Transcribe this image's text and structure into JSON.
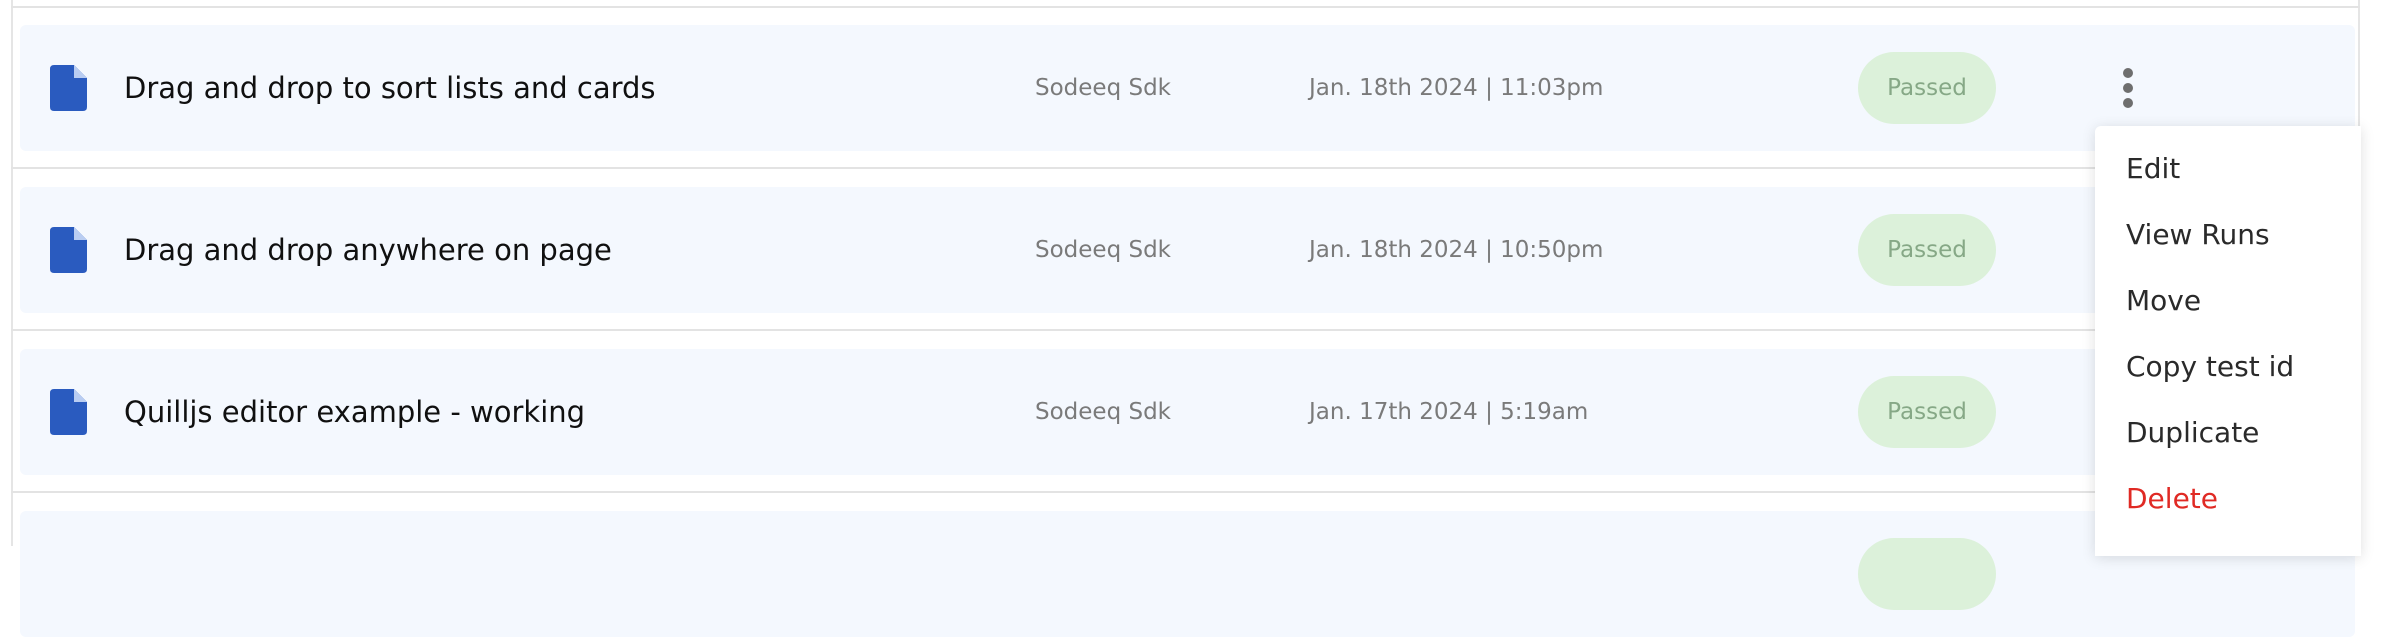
{
  "rows": [
    {
      "title": "Drag and drop to sort lists and cards",
      "author": "Sodeeq Sdk",
      "date": "Jan. 18th 2024 | 11:03pm",
      "status": "Passed"
    },
    {
      "title": "Drag and drop anywhere on page",
      "author": "Sodeeq Sdk",
      "date": "Jan. 18th 2024 | 10:50pm",
      "status": "Passed"
    },
    {
      "title": "Quilljs editor example - working",
      "author": "Sodeeq Sdk",
      "date": "Jan. 17th 2024 | 5:19am",
      "status": "Passed"
    }
  ],
  "menu": {
    "edit": "Edit",
    "view_runs": "View Runs",
    "move": "Move",
    "copy_test_id": "Copy test id",
    "duplicate": "Duplicate",
    "delete": "Delete"
  },
  "colors": {
    "file_icon": "#2a5bbf",
    "row_bg": "#f4f8fe",
    "status_bg": "#dcf1da",
    "status_text": "#86a886",
    "delete_text": "#e02a24"
  },
  "icons": {
    "file": "file-icon",
    "more": "kebab-menu-icon"
  }
}
